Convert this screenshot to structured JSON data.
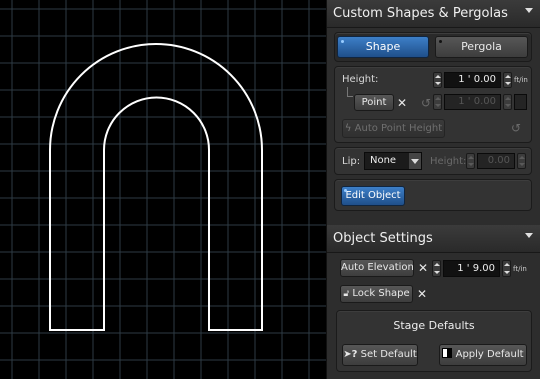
{
  "colors": {
    "canvas_bg": "#000000",
    "grid": "#2e3a44",
    "shape_stroke": "#ffffff",
    "panel_bg": "#2d2d2d",
    "accent_blue": "#2f6db5"
  },
  "custom_shapes": {
    "title": "Custom Shapes & Pergolas",
    "tab_shape": "Shape",
    "tab_pergola": "Pergola",
    "height_label": "Height:",
    "height_value": "1 ' 0.00",
    "height_unit": "ft/in",
    "point_label": "Point",
    "point_value": "1 ' 0.00",
    "auto_point_height_label": "Auto Point Height",
    "lip_label": "Lip:",
    "lip_value": "None",
    "lip_height_label": "Height:",
    "lip_height_value": "0.00",
    "edit_object_label": "Edit Object"
  },
  "object_settings": {
    "title": "Object Settings",
    "auto_elevation_label": "Auto Elevation",
    "elevation_value": "1 ' 9.00",
    "elevation_unit": "ft/in",
    "lock_shape_label": "Lock Shape",
    "stage_defaults_title": "Stage Defaults",
    "set_default_label": "Set Default",
    "apply_default_label": "Apply Default"
  }
}
